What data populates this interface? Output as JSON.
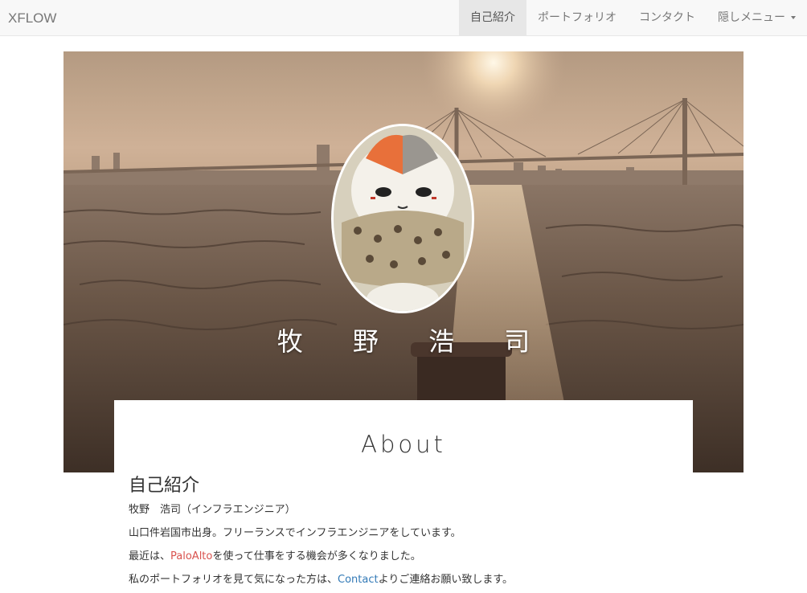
{
  "navbar": {
    "brand": "XFLOW",
    "items": [
      {
        "label": "自己紹介"
      },
      {
        "label": "ポートフォリオ"
      },
      {
        "label": "コンタクト"
      },
      {
        "label": "隠しメニュー"
      }
    ]
  },
  "hero": {
    "name": "牧 野 浩 司"
  },
  "about": {
    "title": "About",
    "heading": "自己紹介",
    "line1": "牧野　浩司（インフラエンジニア）",
    "line2": "山口件岩国市出身。フリーランスでインフラエンジニアをしています。",
    "line3_before": "最近は、",
    "line3_link": "PaloAlto",
    "line3_after": "を使って仕事をする機会が多くなりました。",
    "line4_before": "私のポートフォリオを見て気になった方は、",
    "line4_link": "Contact",
    "line4_after": "よりご連絡お願い致します。"
  },
  "colors": {
    "link_red": "#d9534f",
    "link_blue": "#337ab7",
    "active_nav_bg": "#e7e7e7"
  }
}
